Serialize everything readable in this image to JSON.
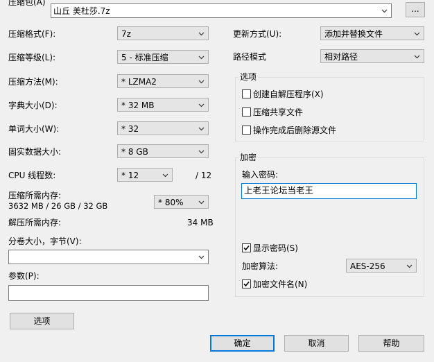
{
  "archive": {
    "label": "压缩包(A)",
    "path": "山丘 美杜莎.7z",
    "browse_label": "..."
  },
  "left": {
    "format": {
      "label": "压缩格式(F):",
      "value": "7z"
    },
    "level": {
      "label": "压缩等级(L):",
      "value": "5 - 标准压缩"
    },
    "method": {
      "label": "压缩方法(M):",
      "value": "* LZMA2"
    },
    "dict": {
      "label": "字典大小(D):",
      "value": "* 32 MB"
    },
    "word": {
      "label": "单词大小(W):",
      "value": "* 32"
    },
    "solid": {
      "label": "固实数据大小:",
      "value": "* 8 GB"
    },
    "threads": {
      "label": "CPU 线程数:",
      "value": "* 12",
      "max": "/ 12"
    },
    "mem_comp": {
      "label": "压缩所需内存:",
      "detail": "3632 MB / 26 GB / 32 GB",
      "value": "* 80%"
    },
    "mem_decomp": {
      "label": "解压所需内存:",
      "value": "34 MB"
    },
    "volume": {
      "label": "分卷大小，字节(V):",
      "value": ""
    },
    "params": {
      "label": "参数(P):",
      "value": ""
    },
    "options_button": "选项"
  },
  "right": {
    "update_mode": {
      "label": "更新方式(U):",
      "value": "添加并替换文件"
    },
    "path_mode": {
      "label": "路径模式",
      "value": "相对路径"
    },
    "options_group": {
      "title": "选项",
      "sfx": "创建自解压程序(X)",
      "shared": "压缩共享文件",
      "delete_after": "操作完成后删除源文件"
    },
    "encryption": {
      "title": "加密",
      "password_label": "输入密码:",
      "password_value": "上老王论坛当老王",
      "show_password": "显示密码(S)",
      "method_label": "加密算法:",
      "method_value": "AES-256",
      "encrypt_names": "加密文件名(N)"
    }
  },
  "buttons": {
    "ok": "确定",
    "cancel": "取消",
    "help": "帮助"
  }
}
